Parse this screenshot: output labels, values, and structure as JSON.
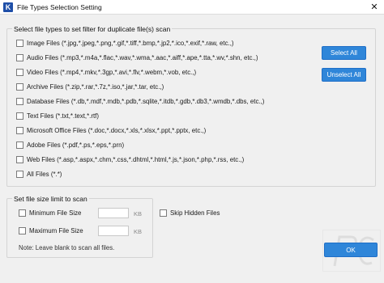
{
  "window": {
    "title": "File Types Selection Setting",
    "icon_letter": "K",
    "close_symbol": "✕"
  },
  "filter_group": {
    "legend": "Select file types to set filter for duplicate file(s) scan",
    "items": [
      {
        "label": "Image Files  (*.jpg,*.jpeg,*.png,*.gif,*.tiff,*.bmp,*.jp2,*.ico,*.exif,*.raw, etc.,)",
        "checked": false
      },
      {
        "label": "Audio Files  (*.mp3,*.m4a,*.flac,*.wav,*.wma,*.aac,*.aiff,*.ape,*.tta,*.wv,*.shn, etc.,)",
        "checked": false
      },
      {
        "label": "Video Files  (*.mp4,*.mkv,*.3gp,*.avi,*.flv,*.webm,*.vob, etc.,)",
        "checked": false
      },
      {
        "label": "Archive Files  (*.zip,*.rar,*.7z,*.iso,*.jar,*.tar, etc.,)",
        "checked": false
      },
      {
        "label": "Database Files  (*.db,*.mdf,*.mdb,*.pdb,*.sqlite,*.itdb,*.gdb,*.db3,*.wmdb,*.dbs, etc.,)",
        "checked": false
      },
      {
        "label": "Text Files  (*.txt,*.text,*.rtf)",
        "checked": false
      },
      {
        "label": "Microsoft Office Files  (*.doc,*.docx,*.xls,*.xlsx,*.ppt,*.pptx, etc.,)",
        "checked": false
      },
      {
        "label": "Adobe Files  (*.pdf,*.ps,*.eps,*.prn)",
        "checked": false
      },
      {
        "label": "Web Files  (*.asp,*.aspx,*.chm,*.css,*.dhtml,*.html,*.js,*.json,*.php,*.rss, etc.,)",
        "checked": false
      },
      {
        "label": "All Files (*.*)",
        "checked": false
      }
    ],
    "select_all_label": "Select All",
    "unselect_all_label": "Unselect All"
  },
  "size_group": {
    "legend": "Set file size limit to scan",
    "min_label": "Minimum File Size",
    "max_label": "Maximum File Size",
    "min_value": "",
    "max_value": "",
    "unit": "KB",
    "note": "Note: Leave blank to scan all files."
  },
  "skip_hidden": {
    "label": "Skip Hidden Files",
    "checked": false
  },
  "ok_label": "OK",
  "colors": {
    "accent": "#2f86d9",
    "title_icon": "#1f4fa8"
  }
}
